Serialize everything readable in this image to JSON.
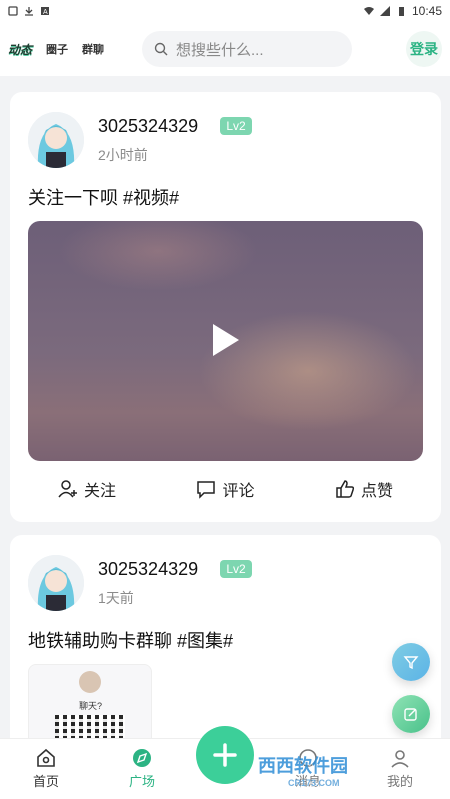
{
  "status_bar": {
    "time": "10:45"
  },
  "header": {
    "tabs": [
      {
        "label": "动态",
        "active": true
      },
      {
        "label": "圈子",
        "active": false
      },
      {
        "label": "群聊",
        "active": false
      }
    ],
    "search_placeholder": "想搜些什么...",
    "login_label": "登录"
  },
  "posts": [
    {
      "username": "3025324329",
      "level": "Lv2",
      "time": "2小时前",
      "text": "关注一下呗 #视频#"
    },
    {
      "username": "3025324329",
      "level": "Lv2",
      "time": "1天前",
      "text": "地铁辅助购卡群聊 #图集#",
      "image_caption": "聊天?"
    }
  ],
  "actions": {
    "follow": "关注",
    "comment": "评论",
    "like": "点赞"
  },
  "bottom_nav": [
    {
      "label": "首页"
    },
    {
      "label": "广场"
    },
    {
      "label": "消息"
    },
    {
      "label": "我的"
    }
  ],
  "watermark": {
    "text": "西西软件园",
    "sub": "CR173.COM"
  },
  "colors": {
    "accent": "#3ccf99",
    "badge": "#7dd6b0"
  }
}
